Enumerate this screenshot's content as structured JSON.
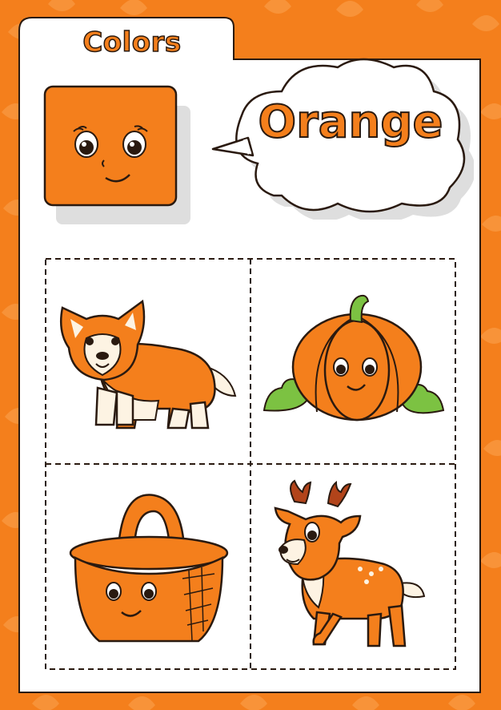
{
  "header": {
    "tab_title": "Colors"
  },
  "word": {
    "label": "Orange"
  },
  "colors": {
    "accent": "#f47f1c",
    "accent_dark": "#d9661a",
    "outline": "#2a1a10",
    "page": "#ffffff",
    "shadow": "#dedede",
    "leaf_green": "#7cc242"
  },
  "pictures": [
    {
      "id": "corgi",
      "icon": "corgi-icon"
    },
    {
      "id": "pumpkin",
      "icon": "pumpkin-icon"
    },
    {
      "id": "basket",
      "icon": "basket-icon"
    },
    {
      "id": "deer",
      "icon": "deer-icon"
    }
  ]
}
